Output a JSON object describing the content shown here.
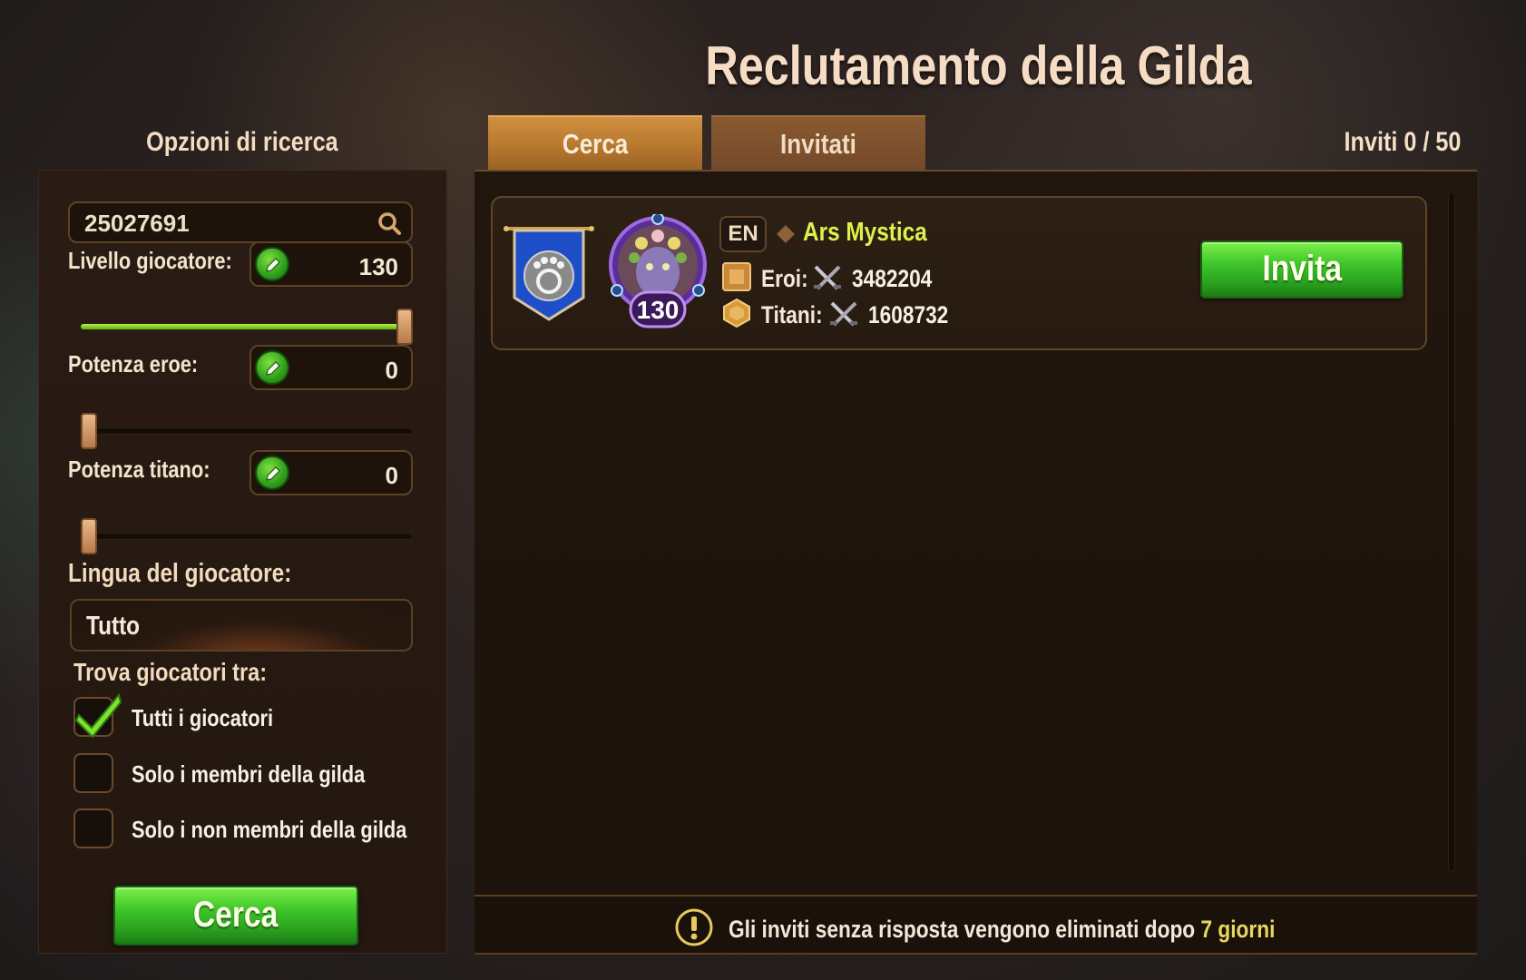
{
  "title": "Reclutamento della Gilda",
  "left": {
    "heading": "Opzioni di ricerca",
    "search_value": "25027691",
    "filters": [
      {
        "label": "Livello giocatore:",
        "value": "130",
        "slider_fraction": 1.0
      },
      {
        "label": "Potenza eroe:",
        "value": "0",
        "slider_fraction": 0.0
      },
      {
        "label": "Potenza titano:",
        "value": "0",
        "slider_fraction": 0.0
      }
    ],
    "language_label": "Lingua del giocatore:",
    "language_value": "Tutto",
    "find_label": "Trova giocatori tra:",
    "options": [
      {
        "label": "Tutti i giocatori",
        "checked": true
      },
      {
        "label": "Solo i membri della gilda",
        "checked": false
      },
      {
        "label": "Solo i non membri della gilda",
        "checked": false
      }
    ],
    "search_button": "Cerca"
  },
  "tabs": [
    {
      "label": "Cerca",
      "active": true
    },
    {
      "label": "Invitati",
      "active": false
    }
  ],
  "invites_count": "Inviti 0 / 50",
  "result": {
    "level": "130",
    "language": "EN",
    "guild_name": "Ars Mystica",
    "heroes_label": "Eroi:",
    "heroes_power": "3482204",
    "titans_label": "Titani:",
    "titans_power": "1608732",
    "invite_button": "Invita"
  },
  "notice": {
    "text": "Gli inviti senza risposta vengono eliminati dopo",
    "highlight": "7 giorni"
  },
  "colors": {
    "accent_green": "#3fc52a",
    "guild_name": "#dff04a",
    "tab_active": "#c0823a"
  }
}
